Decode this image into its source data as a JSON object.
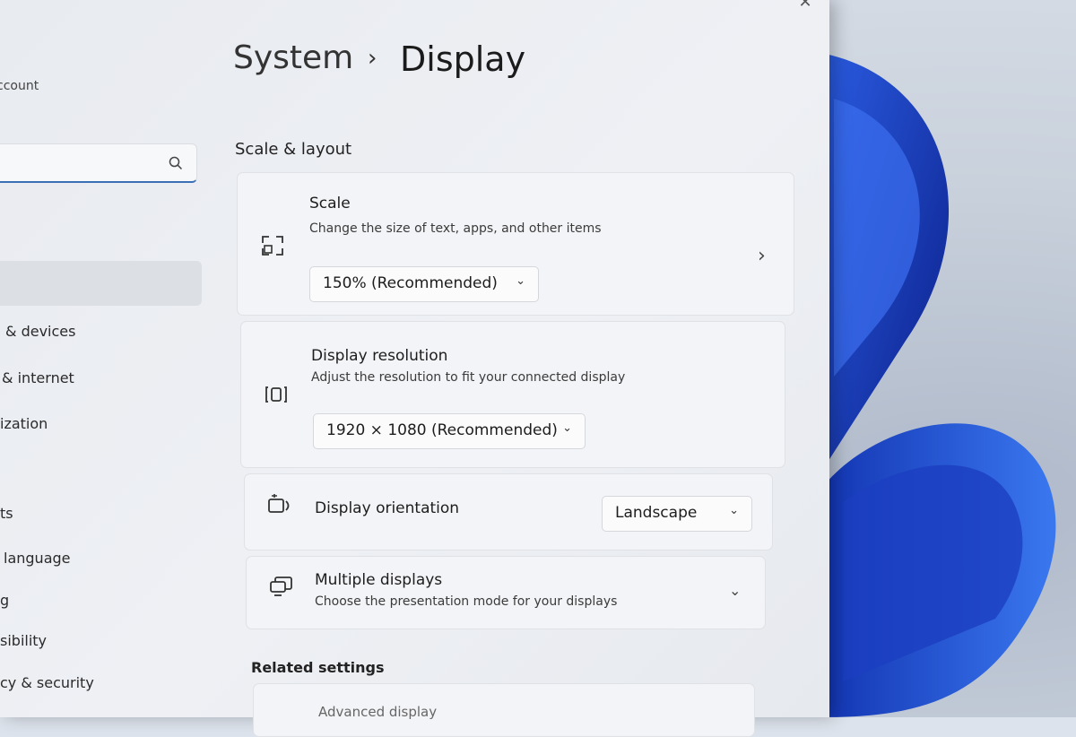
{
  "breadcrumb": {
    "parent": "System",
    "separator": "›",
    "current": "Display"
  },
  "sidebar": {
    "account_label": "ccount",
    "search_placeholder": "",
    "items": [
      {
        "label": "& devices"
      },
      {
        "label": "& internet"
      },
      {
        "label": "ization"
      },
      {
        "label": "ts"
      },
      {
        "label": "language"
      },
      {
        "label": "g"
      },
      {
        "label": "sibility"
      },
      {
        "label": "cy & security"
      }
    ]
  },
  "scale_layout": {
    "section_title": "Scale & layout",
    "scale": {
      "title": "Scale",
      "description": "Change the size of text, apps, and other items",
      "value": "150% (Recommended)"
    },
    "resolution": {
      "title": "Display resolution",
      "description": "Adjust the resolution to fit your connected display",
      "value": "1920 × 1080 (Recommended)"
    },
    "orientation": {
      "title": "Display orientation",
      "value": "Landscape"
    },
    "multiple_displays": {
      "title": "Multiple displays",
      "description": "Choose the presentation mode for your displays"
    }
  },
  "related": {
    "section_title": "Related settings",
    "first_item": "Advanced display"
  },
  "colors": {
    "accent": "#3b6fb6",
    "wallpaper_blue": "#1f47c8"
  }
}
